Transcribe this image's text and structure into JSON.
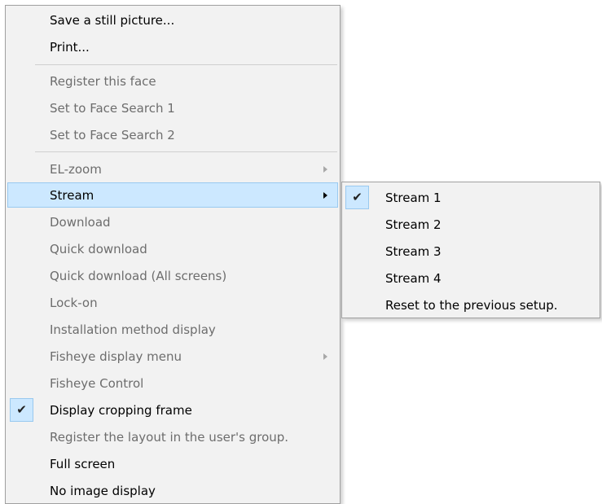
{
  "main_menu": {
    "items": [
      {
        "label": "Save a still picture...",
        "enabled": true
      },
      {
        "label": "Print...",
        "enabled": true
      },
      {
        "label": "Register this face",
        "enabled": false
      },
      {
        "label": "Set to Face Search 1",
        "enabled": false
      },
      {
        "label": "Set to Face Search 2",
        "enabled": false
      },
      {
        "label": "EL-zoom",
        "enabled": false,
        "submenu": true
      },
      {
        "label": "Stream",
        "enabled": true,
        "submenu": true,
        "highlighted": true
      },
      {
        "label": "Download",
        "enabled": false
      },
      {
        "label": "Quick download",
        "enabled": false
      },
      {
        "label": "Quick download (All screens)",
        "enabled": false
      },
      {
        "label": "Lock-on",
        "enabled": false
      },
      {
        "label": "Installation method display",
        "enabled": false
      },
      {
        "label": "Fisheye display menu",
        "enabled": false,
        "submenu": true
      },
      {
        "label": "Fisheye Control",
        "enabled": false
      },
      {
        "label": "Display cropping frame",
        "enabled": true,
        "checked": true
      },
      {
        "label": "Register the layout in the user's group.",
        "enabled": false
      },
      {
        "label": "Full screen",
        "enabled": true
      },
      {
        "label": "No image display",
        "enabled": true
      }
    ]
  },
  "stream_submenu": {
    "items": [
      {
        "label": "Stream 1",
        "checked": true
      },
      {
        "label": "Stream 2"
      },
      {
        "label": "Stream 3"
      },
      {
        "label": "Stream 4"
      },
      {
        "label": "Reset to the previous setup."
      }
    ]
  },
  "icons": {
    "checkmark": "✔",
    "submenu_arrow": "chevron-right-icon"
  },
  "colors": {
    "menu_background": "#f2f2f2",
    "highlight": "#cce8ff",
    "highlight_border": "#99c9ef",
    "disabled_text": "#6d6d6d"
  }
}
